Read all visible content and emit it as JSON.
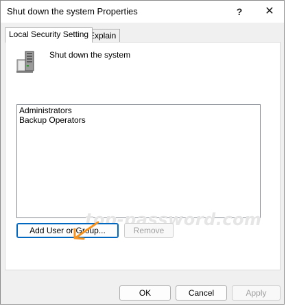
{
  "window": {
    "title": "Shut down the system Properties",
    "help_glyph": "?",
    "close_glyph": "✕"
  },
  "tabs": [
    {
      "label": "Local Security Setting",
      "selected": true
    },
    {
      "label": "Explain",
      "selected": false
    }
  ],
  "policy": {
    "icon": "server-computer-icon",
    "name": "Shut down the system"
  },
  "assigned_to": {
    "items": [
      "Administrators",
      "Backup Operators"
    ]
  },
  "watermark": "top-password.com",
  "annotation": {
    "icon": "orange-arrow-icon",
    "color": "#f7931e"
  },
  "buttons": {
    "add": "Add User or Group...",
    "remove": "Remove",
    "ok": "OK",
    "cancel": "Cancel",
    "apply": "Apply"
  },
  "colors": {
    "accent": "#0067c0",
    "disabled_text": "#a0a0a0"
  }
}
